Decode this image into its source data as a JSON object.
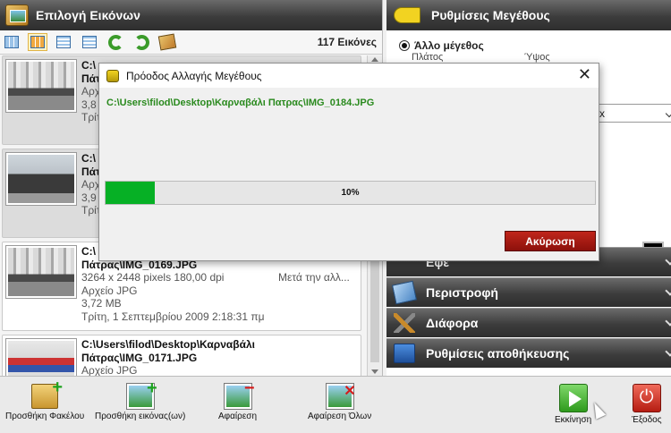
{
  "left_panel": {
    "title": "Επιλογή Εικόνων",
    "count": "117 Εικόνες",
    "toolbar_icons": [
      "thumbnails-view-icon",
      "tiles-view-icon",
      "details-view-icon",
      "list-view-icon",
      "rotate-left-icon",
      "rotate-right-icon",
      "pictures-icon"
    ]
  },
  "items": [
    {
      "path_line1": "C:\\",
      "path_line2": "Πάτ",
      "type": "Αρχείο",
      "size_frag": "3,8",
      "date_frag": "Τρίτ"
    },
    {
      "path_line1": "C:\\",
      "path_line2": "Πάτ",
      "type": "Αρχείο",
      "size_frag": "3,9",
      "date_frag": "Τρίτ"
    },
    {
      "path_line1": "C:\\",
      "path_line2": "Πάτρας\\IMG_0169.JPG",
      "dims": "3264 x 2448 pixels 180,00 dpi",
      "after_text": "Μετά την αλλ...",
      "type": "Αρχείο JPG",
      "size": "3,72 MB",
      "date": "Τρίτη, 1 Σεπτεμβρίου 2009 2:18:31 πμ"
    },
    {
      "path_line1": "C:\\Users\\filod\\Desktop\\Καρναβάλι",
      "path_line2": "Πάτρας\\IMG_0171.JPG",
      "type": "Αρχείο JPG"
    }
  ],
  "right_panel": {
    "title": "Ρυθμίσεις Μεγέθους",
    "radio_label": "Άλλο μέγεθος",
    "width_label": "Πλάτος",
    "height_label": "Ύψος",
    "select_fragment": "x",
    "color_hex": "#000000",
    "sections": [
      {
        "label": "Εφέ",
        "icon": "effects-icon"
      },
      {
        "label": "Περιστροφή",
        "icon": "rotate-icon"
      },
      {
        "label": "Διάφορα",
        "icon": "tools-icon"
      },
      {
        "label": "Ρυθμίσεις αποθήκευσης",
        "icon": "save-settings-icon"
      }
    ]
  },
  "bottom_bar": {
    "add_folder": "Προσθήκη Φακέλου",
    "add_images": "Προσθήκη εικόνας(ων)",
    "remove": "Αφαίρεση",
    "remove_all": "Αφαίρεση Όλων",
    "start": "Εκκίνηση",
    "exit": "Έξοδος"
  },
  "dialog": {
    "title": "Πρόοδος Αλλαγής Μεγέθους",
    "file_path": "C:\\Users\\filod\\Desktop\\Καρναβάλι Πατρας\\IMG_0184.JPG",
    "progress_text": "10%",
    "progress_value": 0.1,
    "progress_color": "#06b025",
    "cancel_label": "Ακύρωση"
  }
}
